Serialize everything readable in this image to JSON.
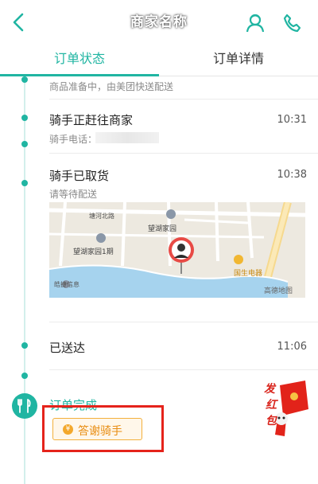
{
  "header": {
    "title": "商家名称",
    "icons": {
      "back": "back-icon",
      "rider": "rider-icon",
      "phone": "phone-icon"
    },
    "accent": "#20b5a2"
  },
  "tabs": [
    {
      "label": "订单状态",
      "active": true
    },
    {
      "label": "订单详情",
      "active": false
    }
  ],
  "timeline": [
    {
      "sub": "商品准备中，由美团快送配送"
    },
    {
      "title": "骑手正赶往商家",
      "sub": "骑手电话：",
      "time": "10:31"
    },
    {
      "title": "骑手已取货",
      "sub": "请等待配送",
      "time": "10:38"
    },
    {
      "title": "已送达",
      "time": "11:06"
    },
    {
      "title": "订单完成"
    }
  ],
  "map": {
    "labels": {
      "road": "塘河北路",
      "complex": "望湖家园",
      "complex_phase1": "望湖家园1期",
      "store": "国生电器",
      "company": "皓捷信息",
      "provider": "高德地图"
    }
  },
  "thank_button": {
    "label": "答谢骑手",
    "coin_symbol": "¥"
  },
  "red_packet": {
    "line1": "发",
    "line2": "红",
    "line3": "包"
  }
}
